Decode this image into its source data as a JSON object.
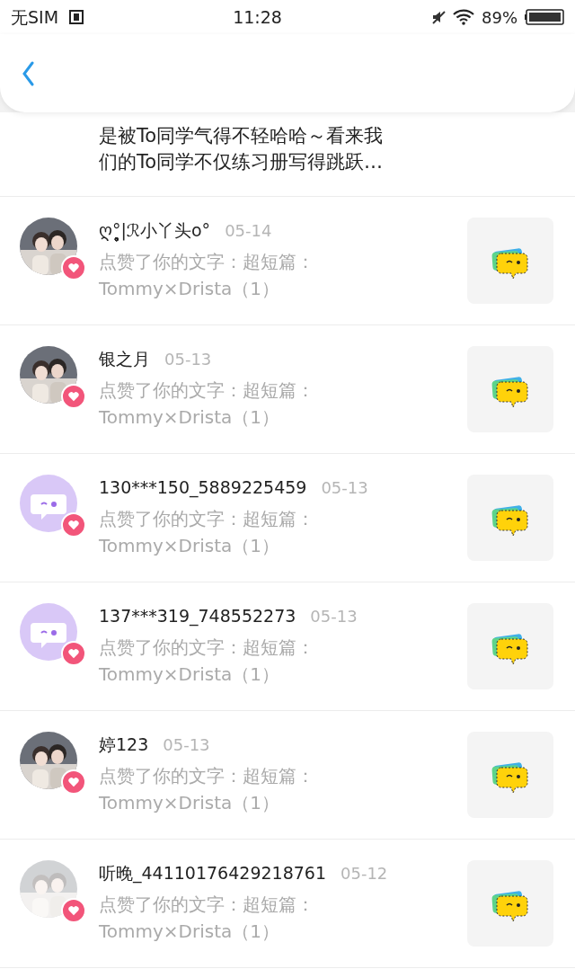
{
  "status_bar": {
    "carrier": "无SIM",
    "time": "11:28",
    "battery": "89%"
  },
  "partial_item": {
    "lines": [
      "是被To同学气得不轻哈哈～看来我",
      "们的To同学不仅练习册写得跳跃…"
    ]
  },
  "notifications": [
    {
      "name": "ღ°̥̥̥̥̥̥̥̥|ℛ小丫头o°",
      "date": "05-14",
      "text": "点赞了你的文字：超短篇：",
      "title": "Tommy×Drista（1）"
    },
    {
      "name": "银之月",
      "date": "05-13",
      "text": "点赞了你的文字：超短篇：",
      "title": "Tommy×Drista（1）"
    },
    {
      "name": "130***150_5889225459",
      "date": "05-13",
      "text": "点赞了你的文字：超短篇：",
      "title": "Tommy×Drista（1）",
      "avatar": {
        "kind": "default"
      }
    },
    {
      "name": "137***319_748552273",
      "date": "05-13",
      "text": "点赞了你的文字：超短篇：",
      "title": "Tommy×Drista（1）",
      "avatar": {
        "kind": "default"
      }
    },
    {
      "name": "婷123",
      "date": "05-13",
      "text": "点赞了你的文字：超短篇：",
      "title": "Tommy×Drista（1）"
    },
    {
      "name": "听晚_44110176429218761",
      "date": "05-12",
      "text": "点赞了你的文字：超短篇：",
      "title": "Tommy×Drista（1）",
      "avatar": {
        "kind": "faded"
      }
    }
  ]
}
